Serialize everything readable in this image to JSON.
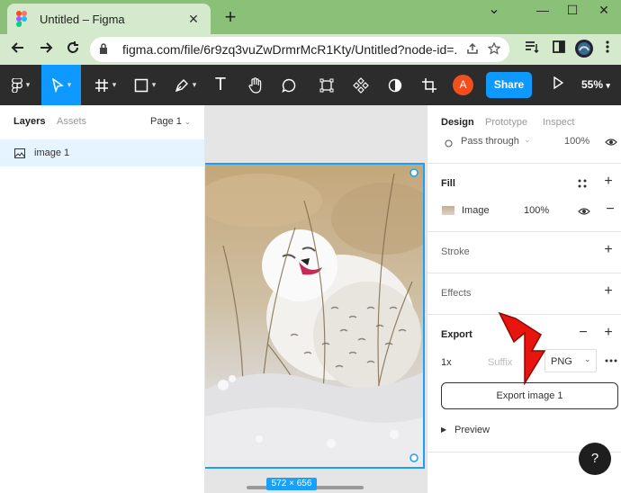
{
  "browser": {
    "tab_title": "Untitled – Figma",
    "tab_close": "✕",
    "new_tab": "+",
    "url": "figma.com/file/6r9zq3vuZwDrmrMcR1Kty/Untitled?node-id=...",
    "window_controls": {
      "minimize": "—",
      "maximize": "☐",
      "close": "✕"
    },
    "collapse": "⌄"
  },
  "toolbar": {
    "text_tool": "T",
    "avatar_initial": "A",
    "share_label": "Share",
    "zoom_label": "55%"
  },
  "left_panel": {
    "tabs": {
      "layers": "Layers",
      "assets": "Assets",
      "page": "Page 1"
    },
    "layers": [
      {
        "name": "image 1"
      }
    ]
  },
  "canvas": {
    "size_badge": "572 × 656"
  },
  "right_panel": {
    "tabs": {
      "design": "Design",
      "prototype": "Prototype",
      "inspect": "Inspect"
    },
    "layer": {
      "blend_mode": "Pass through",
      "opacity": "100%"
    },
    "fill": {
      "title": "Fill",
      "type": "Image",
      "opacity": "100%"
    },
    "stroke": {
      "title": "Stroke"
    },
    "effects": {
      "title": "Effects"
    },
    "export": {
      "title": "Export",
      "scale": "1x",
      "suffix_placeholder": "Suffix",
      "format": "PNG",
      "button_label": "Export image 1",
      "preview_label": "Preview"
    }
  },
  "help": {
    "label": "?"
  },
  "colors": {
    "accent": "#0d99ff",
    "toolbar_bg": "#2c2c2c",
    "browser_frame": "#8bc079",
    "annotation_arrow": "#e8150e"
  }
}
